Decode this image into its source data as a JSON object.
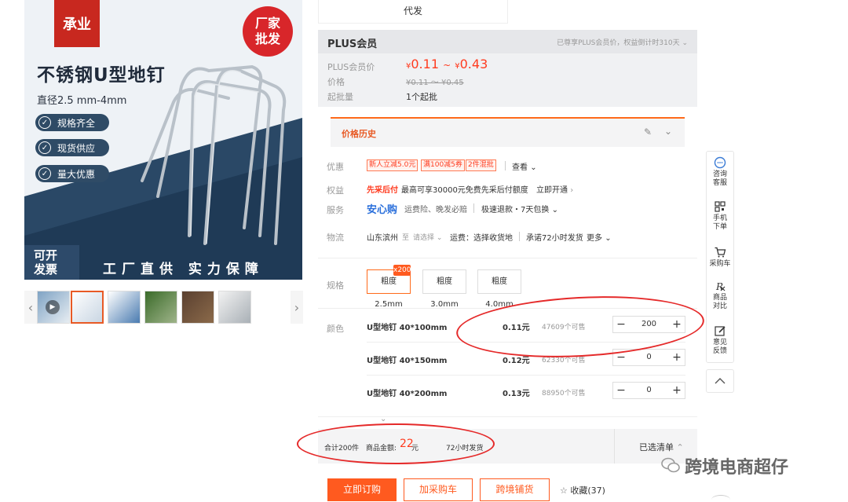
{
  "hero": {
    "brand": "承业",
    "factory_badge_l1": "厂家",
    "factory_badge_l2": "批发",
    "title": "不锈钢U型地钉",
    "spec": "直径2.5 mm-4mm",
    "tags": [
      "规格齐全",
      "现货供应",
      "量大优惠"
    ],
    "invoice_l1": "可开",
    "invoice_l2": "发票",
    "slogan": "工厂直供 实力保障"
  },
  "top_box_label": "代发",
  "plus": {
    "title": "PLUS会员",
    "right_note": "已尊享PLUS会员价，权益倒计时310天",
    "price_label": "PLUS会员价",
    "price_low": "0.11",
    "price_high": "0.43",
    "currency": "¥",
    "tilde": "~",
    "orig_label": "价格",
    "orig_price": "¥0.11 ～ ¥0.45",
    "moq_label": "起批量",
    "moq_value": "1个起批"
  },
  "price_history": {
    "title": "价格历史"
  },
  "promo": {
    "label": "优惠",
    "coupons": [
      "新人立减5.0元",
      "满100减5券",
      "2件混批"
    ],
    "view": "查看"
  },
  "rights": {
    "label": "权益",
    "highlight": "先采后付",
    "text": "最高可享30000元免费先采后付额度",
    "action": "立即开通"
  },
  "service": {
    "label": "服务",
    "highlight": "安心购",
    "text": "运费险、晚发必赔",
    "extra": "极速退款・7天包换"
  },
  "logistics": {
    "label": "物流",
    "origin": "山东滨州",
    "to": "至",
    "dest": "请选择",
    "fee": "运费：选择收货地",
    "promise": "承诺72小时发货",
    "more": "更多"
  },
  "spec": {
    "label": "规格",
    "options": [
      "粗度 2.5mm",
      "粗度 3.0mm",
      "粗度 4.0mm"
    ],
    "badge": "x200"
  },
  "color": {
    "label": "颜色",
    "rows": [
      {
        "name": "U型地钉 40*100mm",
        "price": "0.11元",
        "stock": "47609个可售",
        "qty": "200"
      },
      {
        "name": "U型地钉 40*150mm",
        "price": "0.12元",
        "stock": "62330个可售",
        "qty": "0"
      },
      {
        "name": "U型地钉 40*200mm",
        "price": "0.13元",
        "stock": "88950个可售",
        "qty": "0"
      }
    ],
    "minus": "−",
    "plus": "+"
  },
  "summary": {
    "count": "合计200件",
    "amount_label": "商品金额:",
    "amount": "22",
    "unit": "元",
    "ship": "72小时发货",
    "selected": "已选清单"
  },
  "actions": {
    "order": "立即订购",
    "cart": "加采购车",
    "cross": "跨境铺货",
    "fav": "收藏(37)"
  },
  "sidebar": {
    "items": [
      {
        "l1": "咨询",
        "l2": "客服",
        "icon": "chat-icon"
      },
      {
        "l1": "手机",
        "l2": "下单",
        "icon": "qrcode-icon"
      },
      {
        "l1": "采购车",
        "l2": "",
        "icon": "cart-icon"
      },
      {
        "l1": "商品",
        "l2": "对比",
        "icon": "compare-icon"
      },
      {
        "l1": "意见",
        "l2": "反馈",
        "icon": "edit-icon"
      }
    ]
  },
  "watermark": {
    "text": "跨境电商超仔"
  },
  "colors": {
    "accent": "#ff5a1f",
    "price_red": "#ff3b1f",
    "annotation": "#e52a2a",
    "navy": "#2f4b66"
  }
}
